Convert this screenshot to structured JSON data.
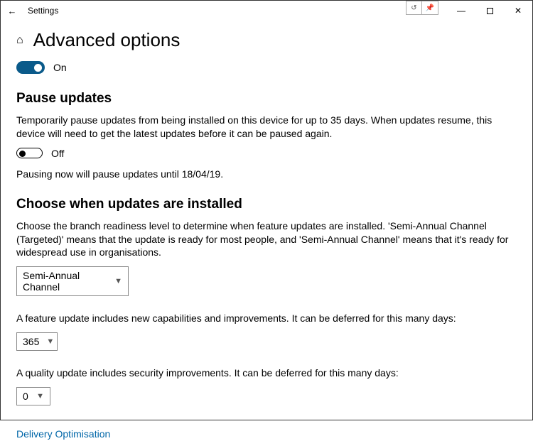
{
  "window": {
    "title": "Settings"
  },
  "page": {
    "title": "Advanced options"
  },
  "main_toggle": {
    "state": "On"
  },
  "pause": {
    "heading": "Pause updates",
    "description": "Temporarily pause updates from being installed on this device for up to 35 days. When updates resume, this device will need to get the latest updates before it can be paused again.",
    "toggle_state": "Off",
    "status": "Pausing now will pause updates until 18/04/19."
  },
  "branch": {
    "heading": "Choose when updates are installed",
    "description": "Choose the branch readiness level to determine when feature updates are installed. 'Semi-Annual Channel (Targeted)' means that the update is ready for most people, and 'Semi-Annual Channel' means that it's ready for widespread use in organisations.",
    "selected": "Semi-Annual Channel"
  },
  "feature_defer": {
    "label": "A feature update includes new capabilities and improvements. It can be deferred for this many days:",
    "value": "365"
  },
  "quality_defer": {
    "label": "A quality update includes security improvements. It can be deferred for this many days:",
    "value": "0"
  },
  "link": {
    "delivery": "Delivery Optimisation"
  }
}
